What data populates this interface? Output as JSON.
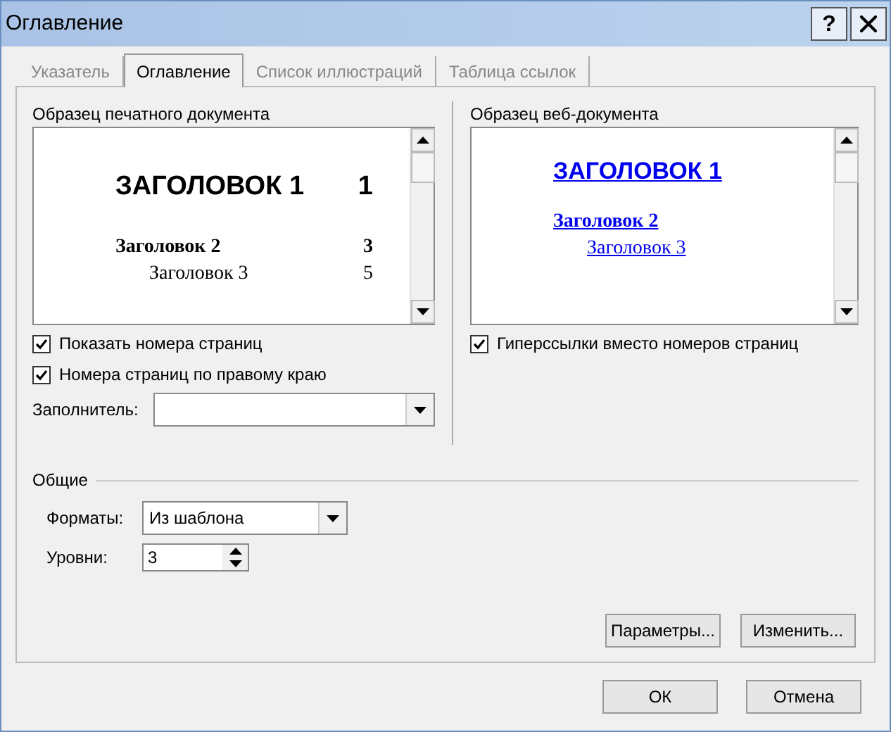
{
  "window": {
    "title": "Оглавление",
    "help": "?"
  },
  "tabs": [
    {
      "label": "Указатель",
      "selected": false
    },
    {
      "label": "Оглавление",
      "selected": true
    },
    {
      "label": "Список иллюстраций",
      "selected": false
    },
    {
      "label": "Таблица ссылок",
      "selected": false
    }
  ],
  "print_preview": {
    "label": "Образец печатного документа",
    "entries": [
      {
        "kind": "h1",
        "text": "ЗАГОЛОВОК 1",
        "page": "1"
      },
      {
        "kind": "h2",
        "text": "Заголовок 2",
        "page": "3"
      },
      {
        "kind": "h3",
        "text": "Заголовок 3",
        "page": "5"
      }
    ]
  },
  "print_options": [
    {
      "label": "Показать номера страниц",
      "checked": true
    },
    {
      "label": "Номера страниц по правому краю",
      "checked": true
    }
  ],
  "leader": {
    "label": "Заполнитель:"
  },
  "web_preview": {
    "label": "Образец веб-документа",
    "entries": [
      {
        "kind": "h1",
        "text": "ЗАГОЛОВОК 1"
      },
      {
        "kind": "h2",
        "text": "Заголовок 2"
      },
      {
        "kind": "h3",
        "text": "Заголовок 3"
      }
    ]
  },
  "web_options": [
    {
      "label": "Гиперссылки вместо номеров страниц",
      "checked": true
    }
  ],
  "general": {
    "title": "Общие",
    "formats": {
      "label": "Форматы:",
      "value": "Из шаблона"
    },
    "levels": {
      "label": "Уровни:",
      "value": "3"
    }
  },
  "panel_buttons": [
    "Параметры...",
    "Изменить..."
  ],
  "dialog_buttons": [
    "ОК",
    "Отмена"
  ]
}
